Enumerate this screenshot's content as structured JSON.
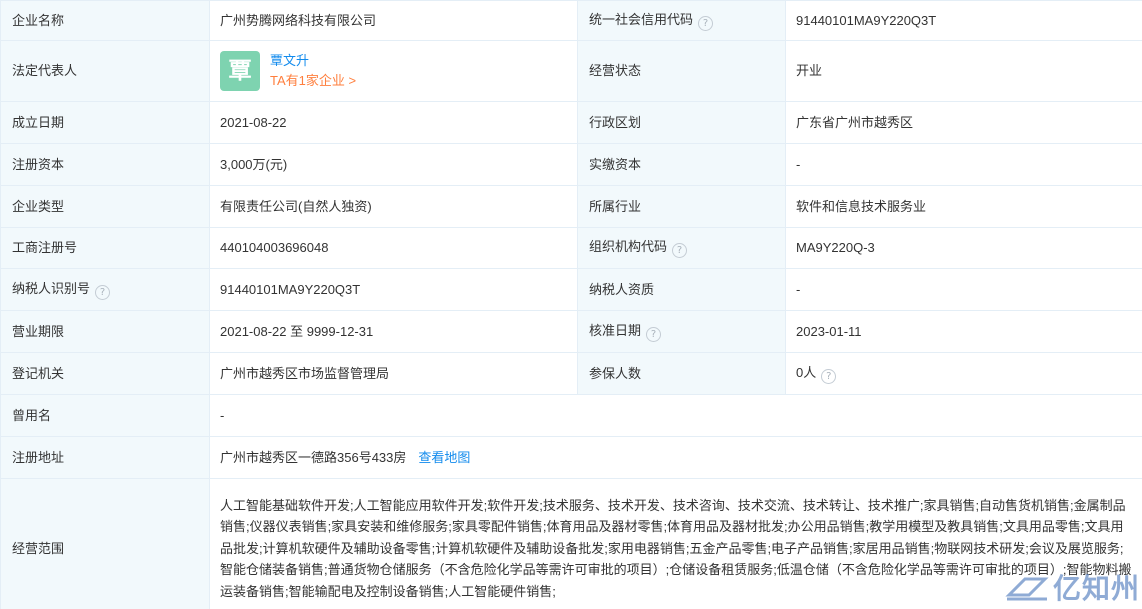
{
  "rows": {
    "r1": {
      "l1": "企业名称",
      "v1": "广州势腾网络科技有限公司",
      "l2": "统一社会信用代码",
      "v2": "91440101MA9Y220Q3T"
    },
    "r2": {
      "l1": "法定代表人",
      "avatar_char": "覃",
      "rep_name": "覃文升",
      "rep_link": "TA有1家企业 >",
      "l2": "经营状态",
      "v2": "开业"
    },
    "r3": {
      "l1": "成立日期",
      "v1": "2021-08-22",
      "l2": "行政区划",
      "v2": "广东省广州市越秀区"
    },
    "r4": {
      "l1": "注册资本",
      "v1": "3,000万(元)",
      "l2": "实缴资本",
      "v2": "-"
    },
    "r5": {
      "l1": "企业类型",
      "v1": "有限责任公司(自然人独资)",
      "l2": "所属行业",
      "v2": "软件和信息技术服务业"
    },
    "r6": {
      "l1": "工商注册号",
      "v1": "440104003696048",
      "l2": "组织机构代码",
      "v2": "MA9Y220Q-3"
    },
    "r7": {
      "l1": "纳税人识别号",
      "v1": "91440101MA9Y220Q3T",
      "l2": "纳税人资质",
      "v2": "-"
    },
    "r8": {
      "l1": "营业期限",
      "v1": "2021-08-22 至 9999-12-31",
      "l2": "核准日期",
      "v2": "2023-01-11"
    },
    "r9": {
      "l1": "登记机关",
      "v1": "广州市越秀区市场监督管理局",
      "l2": "参保人数",
      "v2": "0人"
    },
    "r10": {
      "l1": "曾用名",
      "v1": "-"
    },
    "r11": {
      "l1": "注册地址",
      "v1": "广州市越秀区一德路356号433房",
      "map_link": "查看地图"
    },
    "r12": {
      "l1": "经营范围",
      "v1": "人工智能基础软件开发;人工智能应用软件开发;软件开发;技术服务、技术开发、技术咨询、技术交流、技术转让、技术推广;家具销售;自动售货机销售;金属制品销售;仪器仪表销售;家具安装和维修服务;家具零配件销售;体育用品及器材零售;体育用品及器材批发;办公用品销售;教学用模型及教具销售;文具用品零售;文具用品批发;计算机软硬件及辅助设备零售;计算机软硬件及辅助设备批发;家用电器销售;五金产品零售;电子产品销售;家居用品销售;物联网技术研发;会议及展览服务;智能仓储装备销售;普通货物仓储服务（不含危险化学品等需许可审批的项目）;仓储设备租赁服务;低温仓储（不含危险化学品等需许可审批的项目）;智能物料搬运装备销售;智能输配电及控制设备销售;人工智能硬件销售;"
    }
  },
  "icons": {
    "help": "?"
  },
  "watermark": {
    "text": "亿知州"
  },
  "colors": {
    "label_bg": "#f2f9fc",
    "border": "#e4eef6",
    "link_blue": "#128bed",
    "link_orange": "#ff7f3e",
    "avatar_bg": "#7ed3b0"
  }
}
